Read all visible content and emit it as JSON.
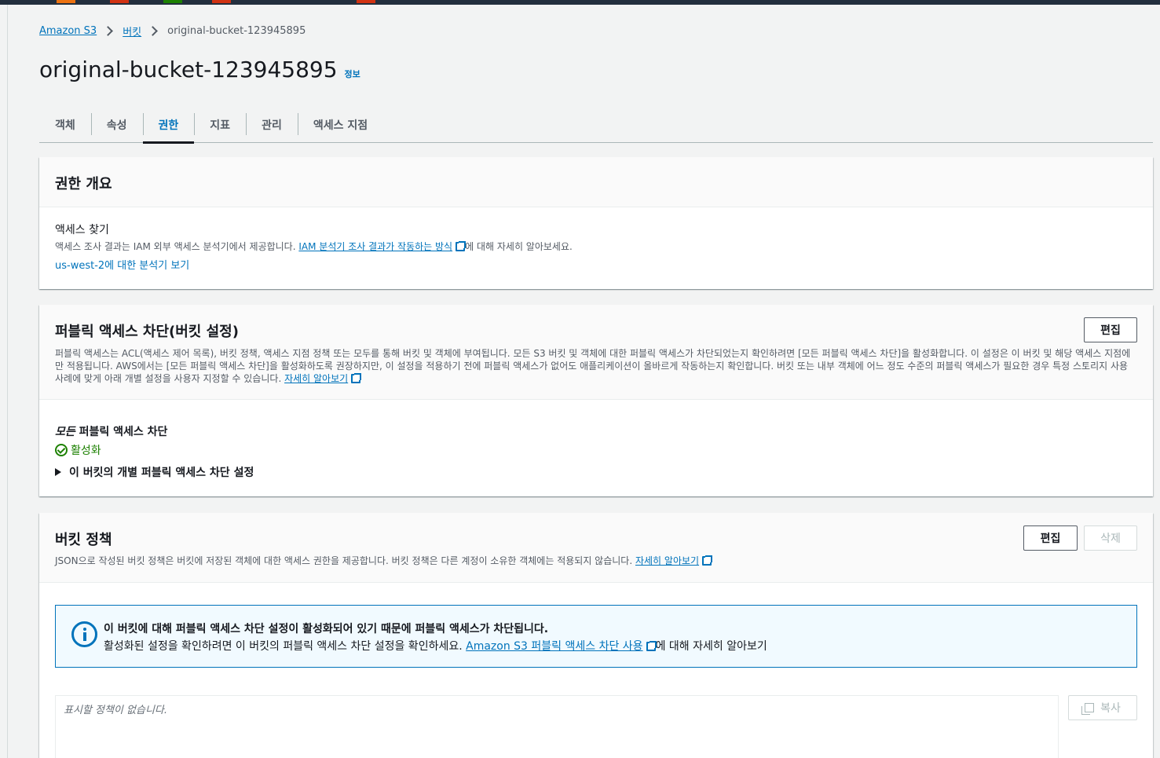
{
  "colors": {
    "topbar": "#232f3e",
    "link": "#0073bb",
    "success": "#1d8102",
    "page_bg": "#f2f3f3"
  },
  "breadcrumb": {
    "item1": "Amazon S3",
    "item2": "버킷",
    "current": "original-bucket-123945895"
  },
  "page": {
    "title": "original-bucket-123945895",
    "info": "정보"
  },
  "tabs": [
    "객체",
    "속성",
    "권한",
    "지표",
    "관리",
    "액세스 지점"
  ],
  "overview": {
    "title": "권한 개요",
    "access_label": "액세스 찾기",
    "desc_prefix": "액세스 조사 결과는 IAM 외부 액세스 분석기에서 제공합니다. ",
    "desc_link": "IAM 분석기 조사 결과가 작동하는 방식",
    "desc_suffix": "에 대해 자세히 알아보세요.",
    "analyzer_link": "us-west-2에 대한 분석기 보기"
  },
  "block_public": {
    "title": "퍼블릭 액세스 차단(버킷 설정)",
    "edit": "편집",
    "desc": "퍼블릭 액세스는 ACL(액세스 제어 목록), 버킷 정책, 액세스 지점 정책 또는 모두를 통해 버킷 및 객체에 부여됩니다. 모든 S3 버킷 및 객체에 대한 퍼블릭 액세스가 차단되었는지 확인하려면 [모든 퍼블릭 액세스 차단]을 활성화합니다. 이 설정은 이 버킷 및 해당 액세스 지점에만 적용됩니다. AWS에서는 [모든 퍼블릭 액세스 차단]을 활성화하도록 권장하지만, 이 설정을 적용하기 전에 퍼블릭 액세스가 없어도 애플리케이션이 올바르게 작동하는지 확인합니다. 버킷 또는 내부 객체에 어느 정도 수준의 퍼블릭 액세스가 필요한 경우 특정 스토리지 사용 사례에 맞게 아래 개별 설정을 사용자 지정할 수 있습니다. ",
    "desc_link": "자세히 알아보기",
    "all_label_em": "모든",
    "all_label_rest": " 퍼블릭 액세스 차단",
    "status": "활성화",
    "expand": "이 버킷의 개별 퍼블릭 액세스 차단 설정"
  },
  "bucket_policy": {
    "title": "버킷 정책",
    "edit": "편집",
    "delete": "삭제",
    "desc": "JSON으로 작성된 버킷 정책은 버킷에 저장된 객체에 대한 액세스 권한을 제공합니다. 버킷 정책은 다른 계정이 소유한 객체에는 적용되지 않습니다. ",
    "desc_link": "자세히 알아보기",
    "alert_title": "이 버킷에 대해 퍼블릭 액세스 차단 설정이 활성화되어 있기 때문에 퍼블릭 액세스가 차단됩니다.",
    "alert_body": "활성화된 설정을 확인하려면 이 버킷의 퍼블릭 액세스 차단 설정을 확인하세요. ",
    "alert_link": "Amazon S3 퍼블릭 액세스 차단 사용",
    "alert_suffix": "에 대해 자세히 알아보기",
    "placeholder": "표시할 정책이 없습니다.",
    "copy": "복사"
  }
}
